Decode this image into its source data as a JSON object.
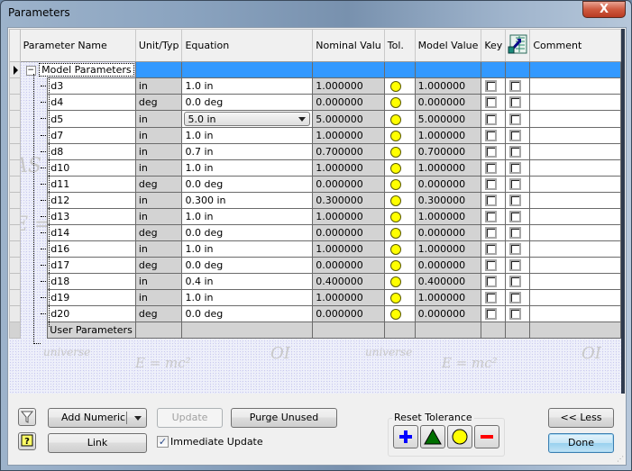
{
  "window": {
    "title": "Parameters",
    "close_label": "X"
  },
  "grid": {
    "headers": {
      "name": "Parameter Name",
      "unit": "Unit/Typ",
      "equation": "Equation",
      "nominal": "Nominal Valu",
      "tol": "Tol.",
      "model": "Model Value",
      "key": "Key",
      "export_icon": "export-parameter-icon",
      "comment": "Comment"
    },
    "groups": {
      "model": {
        "label": "Model Parameters",
        "expander": "−"
      },
      "user": {
        "label": "User Parameters"
      }
    },
    "rows": [
      {
        "name": "d3",
        "unit": "in",
        "equation": "1.0 in",
        "nominal": "1.000000",
        "tol": "yellow-circle",
        "model": "1.000000",
        "key": false,
        "export": false,
        "comment": ""
      },
      {
        "name": "d4",
        "unit": "deg",
        "equation": "0.0 deg",
        "nominal": "0.000000",
        "tol": "yellow-circle",
        "model": "0.000000",
        "key": false,
        "export": false,
        "comment": ""
      },
      {
        "name": "d5",
        "unit": "in",
        "equation": "5.0 in",
        "nominal": "5.000000",
        "tol": "yellow-circle",
        "model": "5.000000",
        "key": false,
        "export": false,
        "comment": "",
        "editing": true
      },
      {
        "name": "d7",
        "unit": "in",
        "equation": "1.0 in",
        "nominal": "1.000000",
        "tol": "yellow-circle",
        "model": "1.000000",
        "key": false,
        "export": false,
        "comment": ""
      },
      {
        "name": "d8",
        "unit": "in",
        "equation": "0.7 in",
        "nominal": "0.700000",
        "tol": "yellow-circle",
        "model": "0.700000",
        "key": false,
        "export": false,
        "comment": ""
      },
      {
        "name": "d10",
        "unit": "in",
        "equation": "1.0 in",
        "nominal": "1.000000",
        "tol": "yellow-circle",
        "model": "1.000000",
        "key": false,
        "export": false,
        "comment": ""
      },
      {
        "name": "d11",
        "unit": "deg",
        "equation": "0.0 deg",
        "nominal": "0.000000",
        "tol": "yellow-circle",
        "model": "0.000000",
        "key": false,
        "export": false,
        "comment": ""
      },
      {
        "name": "d12",
        "unit": "in",
        "equation": "0.300 in",
        "nominal": "0.300000",
        "tol": "yellow-circle",
        "model": "0.300000",
        "key": false,
        "export": false,
        "comment": ""
      },
      {
        "name": "d13",
        "unit": "in",
        "equation": "1.0 in",
        "nominal": "1.000000",
        "tol": "yellow-circle",
        "model": "1.000000",
        "key": false,
        "export": false,
        "comment": ""
      },
      {
        "name": "d14",
        "unit": "deg",
        "equation": "0.0 deg",
        "nominal": "0.000000",
        "tol": "yellow-circle",
        "model": "0.000000",
        "key": false,
        "export": false,
        "comment": ""
      },
      {
        "name": "d16",
        "unit": "in",
        "equation": "1.0 in",
        "nominal": "1.000000",
        "tol": "yellow-circle",
        "model": "1.000000",
        "key": false,
        "export": false,
        "comment": ""
      },
      {
        "name": "d17",
        "unit": "deg",
        "equation": "0.0 deg",
        "nominal": "0.000000",
        "tol": "yellow-circle",
        "model": "0.000000",
        "key": false,
        "export": false,
        "comment": ""
      },
      {
        "name": "d18",
        "unit": "in",
        "equation": "0.4 in",
        "nominal": "0.400000",
        "tol": "yellow-circle",
        "model": "0.400000",
        "key": false,
        "export": false,
        "comment": ""
      },
      {
        "name": "d19",
        "unit": "in",
        "equation": "1.0 in",
        "nominal": "1.000000",
        "tol": "yellow-circle",
        "model": "1.000000",
        "key": false,
        "export": false,
        "comment": ""
      },
      {
        "name": "d20",
        "unit": "deg",
        "equation": "0.0 deg",
        "nominal": "0.000000",
        "tol": "yellow-circle",
        "model": "0.000000",
        "key": false,
        "export": false,
        "comment": ""
      }
    ],
    "watermark": {
      "t1": "AS",
      "t2": "universe",
      "t3": "E = mc²",
      "t4": "OI"
    }
  },
  "buttons": {
    "add_numeric": "Add Numeric",
    "update": "Update",
    "purge_unused": "Purge Unused",
    "link": "Link",
    "immediate_update": "Immediate Update",
    "immediate_update_checked": true,
    "less": "<< Less",
    "done": "Done"
  },
  "reset_tolerance": {
    "label": "Reset Tolerance",
    "buttons": [
      "upper-plus",
      "median-triangle",
      "nominal-circle",
      "lower-minus"
    ]
  },
  "colors": {
    "selection": "#3399ff",
    "tolerance_nominal": "#ffff00",
    "plus": "#0000ff",
    "triangle": "#007000",
    "minus": "#ff0000"
  }
}
